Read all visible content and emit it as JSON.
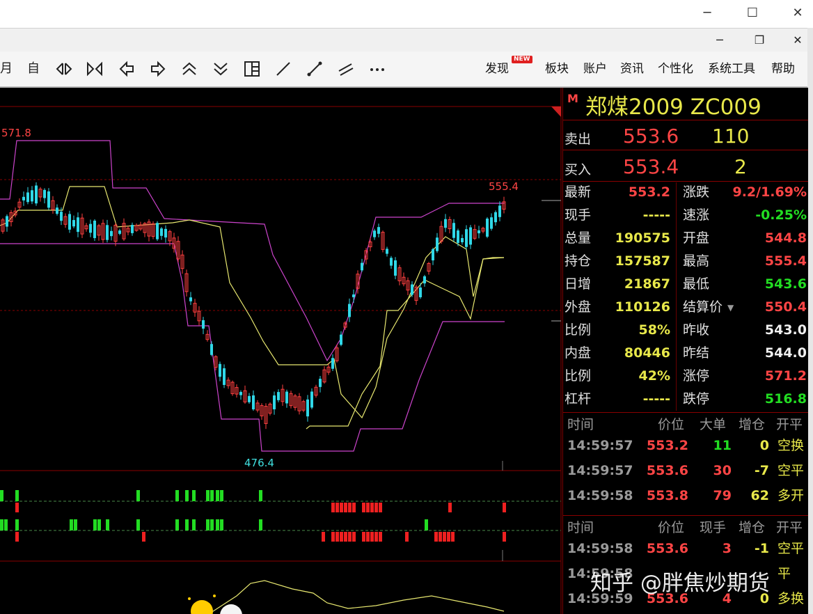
{
  "window": {
    "minimize": "─",
    "maximize": "☐",
    "close": "✕"
  },
  "subwindow": {
    "minimize": "─",
    "restore": "❐",
    "close": "✕"
  },
  "toolbar": {
    "month": "月",
    "self": "自",
    "icons": [
      "expand-horizontal-icon",
      "shrink-horizontal-icon",
      "arrow-left-icon",
      "arrow-right-icon",
      "double-up-icon",
      "double-down-icon",
      "layout-grid-icon",
      "line-tool-icon",
      "segment-tool-icon",
      "parallel-lines-icon",
      "more-icon"
    ],
    "menus": [
      "发现",
      "板块",
      "账户",
      "资讯",
      "个性化",
      "系统工具",
      "帮助"
    ],
    "new_badge": "NEW"
  },
  "chart_labels": {
    "high": "571.8",
    "last_high": "555.4",
    "low": "476.4"
  },
  "quote": {
    "market_flag": "M",
    "title": "郑煤2009  ZC009",
    "sell_label": "卖出",
    "sell_price": "553.6",
    "sell_vol": "110",
    "buy_label": "买入",
    "buy_price": "553.4",
    "buy_vol": "2",
    "rows_left": [
      {
        "label": "最新",
        "value": "553.2",
        "color": "red"
      },
      {
        "label": "现手",
        "value": "-----",
        "color": "yel"
      },
      {
        "label": "总量",
        "value": "190575",
        "color": "yel"
      },
      {
        "label": "持仓",
        "value": "157587",
        "color": "yel"
      },
      {
        "label": "日增",
        "value": "21867",
        "color": "yel"
      },
      {
        "label": "外盘",
        "value": "110126",
        "color": "yel"
      },
      {
        "label": "比例",
        "value": "58%",
        "color": "yel"
      },
      {
        "label": "内盘",
        "value": "80446",
        "color": "yel"
      },
      {
        "label": "比例",
        "value": "42%",
        "color": "yel"
      },
      {
        "label": "杠杆",
        "value": "-----",
        "color": "yel"
      }
    ],
    "rows_right": [
      {
        "label": "涨跌",
        "value": "9.2/1.69%",
        "color": "red"
      },
      {
        "label": "速涨",
        "value": "-0.25%",
        "color": "green"
      },
      {
        "label": "开盘",
        "value": "544.8",
        "color": "red"
      },
      {
        "label": "最高",
        "value": "555.4",
        "color": "red"
      },
      {
        "label": "最低",
        "value": "543.6",
        "color": "green"
      },
      {
        "label": "结算价",
        "value": "550.4",
        "color": "red"
      },
      {
        "label": "昨收",
        "value": "543.0",
        "color": "wht"
      },
      {
        "label": "昨结",
        "value": "544.0",
        "color": "wht"
      },
      {
        "label": "涨停",
        "value": "571.2",
        "color": "red"
      },
      {
        "label": "跌停",
        "value": "516.8",
        "color": "green"
      }
    ],
    "ticks1_header": [
      "时间",
      "价位",
      "大单",
      "增仓",
      "开平"
    ],
    "ticks1": [
      {
        "time": "14:59:57",
        "price": "553.2",
        "vol": "11",
        "vol_color": "green",
        "oi": "0",
        "oi_color": "yel",
        "type": "空换",
        "type_color": "yel"
      },
      {
        "time": "14:59:57",
        "price": "553.6",
        "vol": "30",
        "vol_color": "red",
        "oi": "-7",
        "oi_color": "yel",
        "type": "空平",
        "type_color": "yel"
      },
      {
        "time": "14:59:58",
        "price": "553.8",
        "vol": "79",
        "vol_color": "red",
        "oi": "62",
        "oi_color": "yel",
        "type": "多开",
        "type_color": "yel"
      }
    ],
    "ticks2_header": [
      "时间",
      "价位",
      "现手",
      "增仓",
      "开平"
    ],
    "ticks2": [
      {
        "time": "14:59:58",
        "price": "553.6",
        "vol": "3",
        "vol_color": "red",
        "oi": "-1",
        "oi_color": "yel",
        "type": "空平",
        "type_color": "yel"
      },
      {
        "time": "14:59:58",
        "price": "",
        "vol": "",
        "vol_color": "red",
        "oi": "",
        "oi_color": "yel",
        "type": "平",
        "type_color": "yel"
      },
      {
        "time": "14:59:59",
        "price": "553.6",
        "vol": "4",
        "vol_color": "red",
        "oi": "0",
        "oi_color": "yel",
        "type": "多换",
        "type_color": "yel"
      }
    ]
  },
  "watermark": "知乎 @胖焦炒期货",
  "colors": {
    "up": "#ff4040",
    "down": "#30d8e8",
    "band": "#cc44cc",
    "mid": "#e8e870",
    "grid": "#8a0000"
  }
}
